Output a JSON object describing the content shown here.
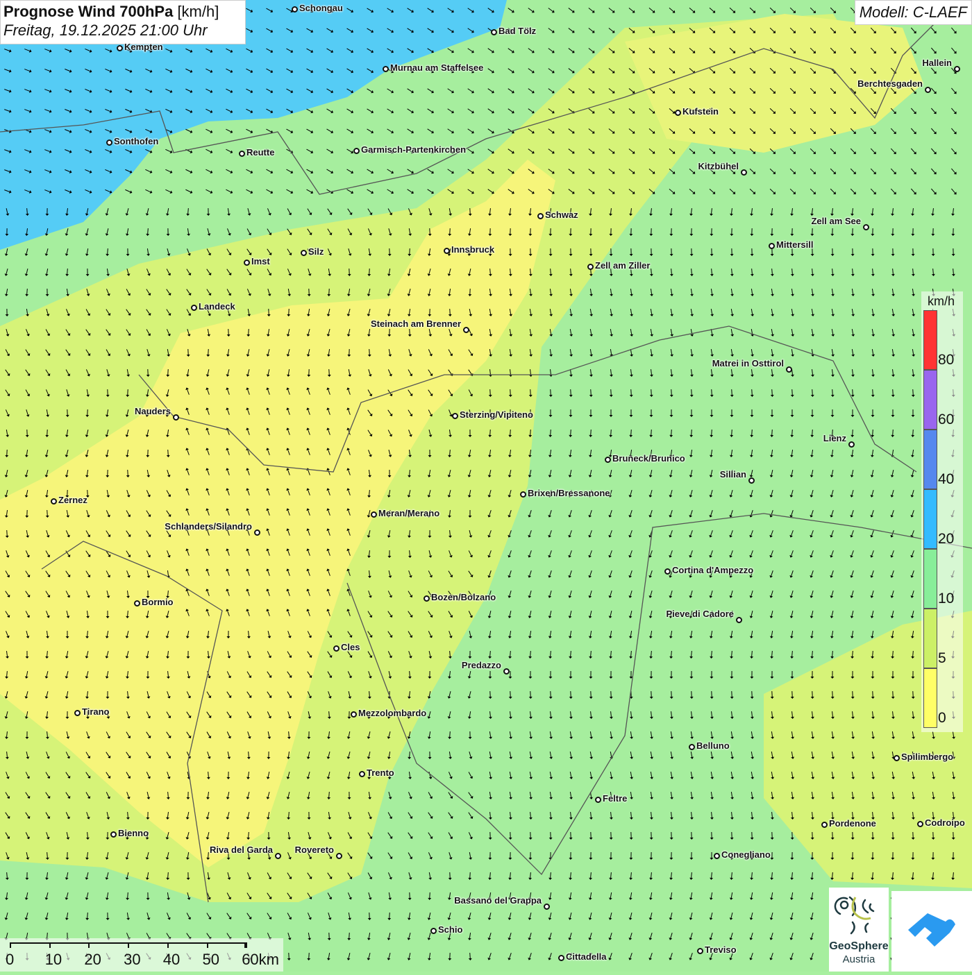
{
  "header": {
    "title": "Prognose Wind 700hPa",
    "unit": "[km/h]",
    "datetime": "Freitag, 19.12.2025 21:00 Uhr",
    "model": "Modell: C-LAEF"
  },
  "cities": [
    "Schongau",
    "Bad Tölz",
    "Kempten",
    "Murnau am Staffelsee",
    "Hallein",
    "Berchtesgaden",
    "Kufstein",
    "Sonthofen",
    "Reutte",
    "Garmisch-Partenkirchen",
    "Kitzbühel",
    "Schwaz",
    "Zell am See",
    "Innsbruck",
    "Silz",
    "Mittersill",
    "Imst",
    "Zell am Ziller",
    "Landeck",
    "Steinach am Brenner",
    "Matrei in Osttirol",
    "Nauders",
    "Sterzing/Vipiteno",
    "Lienz",
    "Bruneck/Brunico",
    "Sillian",
    "Brixen/Bressanone",
    "Zernez",
    "Meran/Merano",
    "Schlanders/Silandro",
    "Cortina d'Ampezzo",
    "Bozen/Bolzano",
    "Bormio",
    "Pieve di Cadore",
    "Cles",
    "Predazzo",
    "Tirano",
    "Mezzolombardo",
    "Belluno",
    "Spilimbergo",
    "Trento",
    "Feltre",
    "Pordenone",
    "Codroipo",
    "Bienno",
    "Riva del Garda",
    "Rovereto",
    "Conegliano",
    "Bassano del Grappa",
    "Schio",
    "Treviso",
    "Cittadella"
  ],
  "legend": {
    "unit": "km/h",
    "labels": [
      "80",
      "60",
      "40",
      "20",
      "10",
      "5",
      "0"
    ],
    "colors": [
      "#ff3333",
      "#9966ee",
      "#5588ee",
      "#33bbff",
      "#88ee99",
      "#ccf066",
      "#ffff66"
    ]
  },
  "scale": {
    "labels": [
      "0",
      "10",
      "20",
      "30",
      "40",
      "50",
      "60km"
    ]
  },
  "logos": {
    "geosphere_line1": "GeoSphere",
    "geosphere_line2": "Austria"
  },
  "colors": {
    "cyan": "#55ccf5",
    "green": "#a6ee9e",
    "lime": "#d9f57a",
    "yellow": "#f6f57a"
  }
}
